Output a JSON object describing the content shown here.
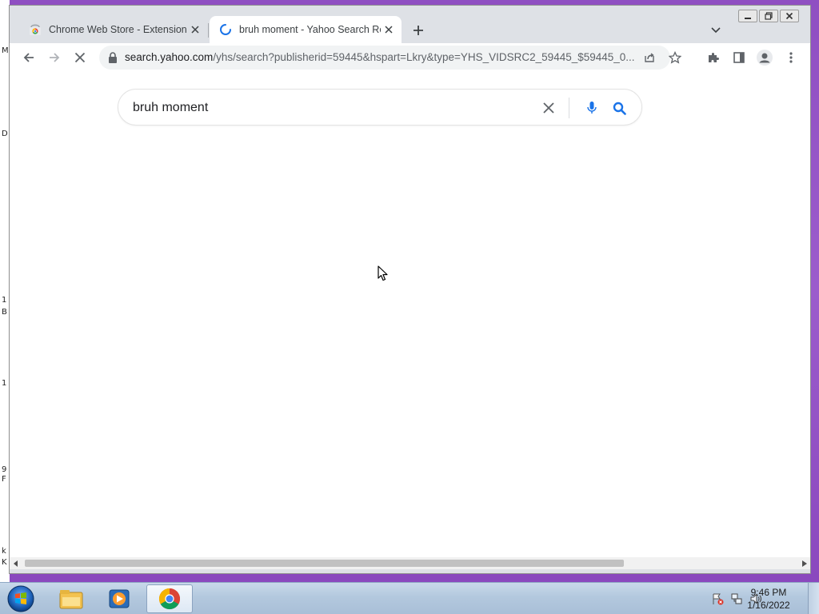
{
  "desktop": {
    "edge_letters": [
      "M",
      "D",
      "1",
      "B",
      "1",
      "9",
      "F",
      "k",
      "K"
    ]
  },
  "window": {
    "controls": {
      "minimize": "minimize-icon",
      "restore": "restore-icon",
      "close": "close-icon"
    }
  },
  "tabs": [
    {
      "title": "Chrome Web Store - Extensions",
      "favicon": "chrome-web-store-icon",
      "active": false
    },
    {
      "title": "bruh moment - Yahoo Search Re",
      "favicon": "loading-spinner-icon",
      "active": true
    }
  ],
  "toolbar": {
    "url_host": "search.yahoo.com",
    "url_path": "/yhs/search?publisherid=59445&hspart=Lkry&type=YHS_VIDSRC2_59445_$59445_0...",
    "icons": [
      "back-icon",
      "forward-icon",
      "stop-icon",
      "lock-icon",
      "share-icon",
      "star-icon",
      "extensions-icon",
      "side-panel-icon",
      "profile-icon",
      "menu-icon"
    ]
  },
  "search": {
    "query": "bruh moment"
  },
  "taskbar": {
    "apps": [
      "windows-explorer",
      "windows-media-player",
      "google-chrome"
    ],
    "clock_time": "9:46 PM",
    "clock_date": "1/16/2022"
  },
  "colors": {
    "desktop": "#9a57c9",
    "search_icon_blue": "#1a73e8",
    "tab_strip": "#dee1e6"
  }
}
